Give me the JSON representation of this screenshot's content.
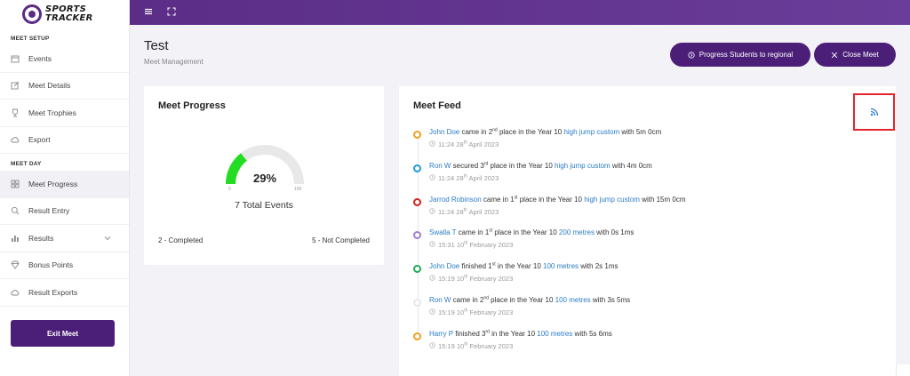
{
  "brand": {
    "line1": "SPORTS",
    "line2": "TRACKER"
  },
  "sidebar": {
    "section_setup": "MEET SETUP",
    "section_day": "MEET DAY",
    "setup_items": [
      {
        "label": "Events",
        "icon": "calendar-icon"
      },
      {
        "label": "Meet Details",
        "icon": "edit-icon"
      },
      {
        "label": "Meet Trophies",
        "icon": "trophy-icon"
      },
      {
        "label": "Export",
        "icon": "cloud-upload-icon"
      }
    ],
    "day_items": [
      {
        "label": "Meet Progress",
        "icon": "grid-icon",
        "active": true
      },
      {
        "label": "Result Entry",
        "icon": "search-icon"
      },
      {
        "label": "Results",
        "icon": "bar-chart-icon"
      },
      {
        "label": "Bonus Points",
        "icon": "diamond-icon"
      },
      {
        "label": "Result Exports",
        "icon": "cloud-upload-icon"
      }
    ],
    "exit_label": "Exit Meet"
  },
  "header": {
    "title": "Test",
    "subtitle": "Meet Management",
    "progress_button": "Progress Students to regional",
    "close_button": "Close Meet"
  },
  "progress": {
    "title": "Meet Progress",
    "percent": 29,
    "percent_label": "29%",
    "min": "0",
    "max": "100",
    "total_events": "7 Total Events",
    "completed": "2 - Completed",
    "not_completed": "5 - Not Completed"
  },
  "feed": {
    "title": "Meet Feed",
    "items": [
      {
        "name": "John Doe",
        "pre": " came in 2",
        "ord": "nd",
        "mid": " place in the Year 10 ",
        "event": "high jump custom",
        "post": " with 5m 0cm",
        "time_pre": "11:24 28",
        "time_ord": "th",
        "time_post": " April 2023",
        "color": "#f0a020"
      },
      {
        "name": "Ron W",
        "pre": " secured 3",
        "ord": "rd",
        "mid": " place in the Year 10 ",
        "event": "high jump custom",
        "post": " with 4m 0cm",
        "time_pre": "11:24 28",
        "time_ord": "th",
        "time_post": " April 2023",
        "color": "#1e9bd7"
      },
      {
        "name": "Jarrod Robinson",
        "pre": " came in 1",
        "ord": "st",
        "mid": " place in the Year 10 ",
        "event": "high jump custom",
        "post": " with 15m 0cm",
        "time_pre": "11:24 28",
        "time_ord": "th",
        "time_post": " April 2023",
        "color": "#d42020"
      },
      {
        "name": "Swalla T",
        "pre": " came in 1",
        "ord": "st",
        "mid": " place in the Year 10 ",
        "event": "200 metres",
        "post": " with 0s 1ms",
        "time_pre": "15:31 10",
        "time_ord": "th",
        "time_post": " February 2023",
        "color": "#9b7fd4"
      },
      {
        "name": "John Doe",
        "pre": " finished 1",
        "ord": "st",
        "mid": " in the Year 10 ",
        "event": "100 metres",
        "post": " with 2s 1ms",
        "time_pre": "15:19 10",
        "time_ord": "th",
        "time_post": " February 2023",
        "color": "#1faa55"
      },
      {
        "name": "Ron W",
        "pre": " came in 2",
        "ord": "nd",
        "mid": " place in the Year 10 ",
        "event": "100 metres",
        "post": " with 3s 5ms",
        "time_pre": "15:19 10",
        "time_ord": "th",
        "time_post": " February 2023",
        "color": "#e6e6ea"
      },
      {
        "name": "Harry P",
        "pre": " finished 3",
        "ord": "rd",
        "mid": " in the Year 10 ",
        "event": "100 metres",
        "post": " with 5s 6ms",
        "time_pre": "15:19 10",
        "time_ord": "th",
        "time_post": " February 2023",
        "color": "#f0a020"
      }
    ]
  },
  "colors": {
    "accent": "#4b1f78",
    "topbar": "#5b2d86",
    "link": "#2b7cc7",
    "gauge": "#22dd22",
    "highlight": "#e3242b"
  }
}
